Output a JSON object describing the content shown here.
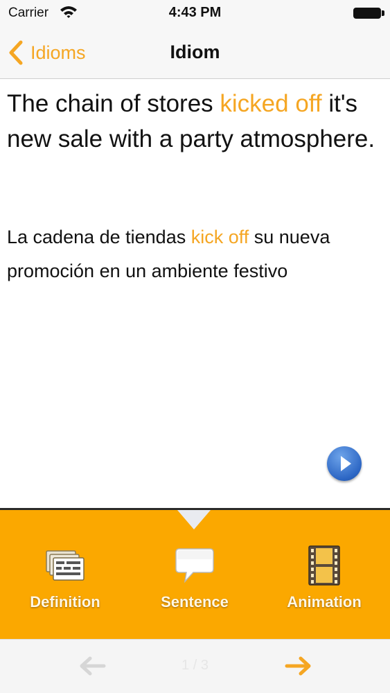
{
  "status_bar": {
    "carrier": "Carrier",
    "time": "4:43 PM"
  },
  "nav": {
    "back_label": "Idioms",
    "title": "Idiom"
  },
  "content": {
    "english": {
      "before": "The chain of stores ",
      "highlight": "kicked off",
      "after": " it's new sale with a party atmosphere."
    },
    "spanish": {
      "before": "La cadena de tiendas ",
      "highlight": "kick off",
      "after": " su nueva promoción en un ambiente festivo"
    }
  },
  "tabs": [
    {
      "label": "Definition",
      "icon": "definition-cards-icon"
    },
    {
      "label": "Sentence",
      "icon": "speech-bubble-icon"
    },
    {
      "label": "Animation",
      "icon": "film-strip-icon"
    }
  ],
  "bottom": {
    "page_indicator": "1 / 3"
  },
  "colors": {
    "accent": "#f5a623",
    "tab_bar": "#fba800",
    "nav_bg": "#f7f7f7",
    "play_button": "#2c66c4"
  }
}
